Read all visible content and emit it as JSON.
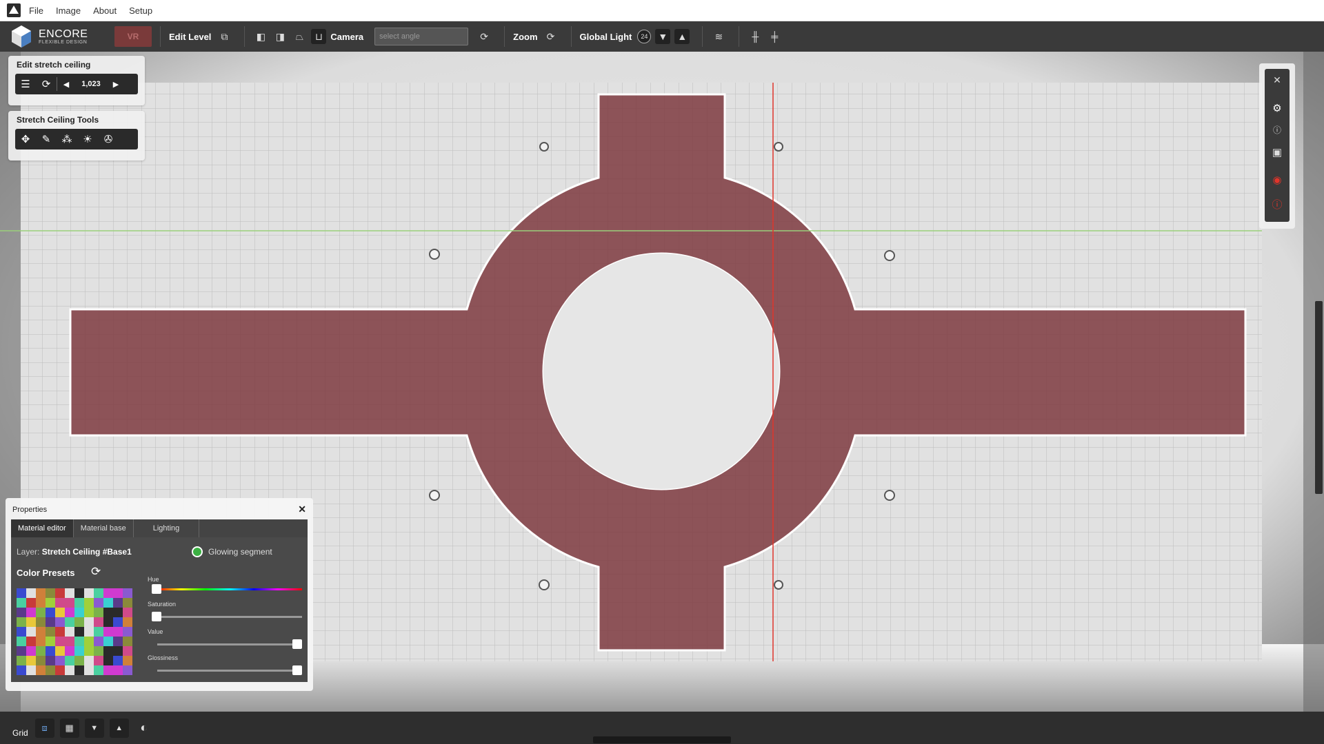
{
  "menubar": {
    "items": [
      "File",
      "Image",
      "About",
      "Setup"
    ]
  },
  "brand": {
    "name": "ENCORE",
    "subtitle": "FLEXIBLE DESIGN",
    "vr_label": "VR"
  },
  "toolbar": {
    "edit_level_label": "Edit Level",
    "camera_label": "Camera",
    "select_angle_placeholder": "select angle",
    "zoom_label": "Zoom",
    "global_light_label": "Global Light",
    "global_light_value": "24"
  },
  "edit_panel": {
    "title": "Edit stretch ceiling",
    "value": "1,023"
  },
  "tools_panel": {
    "title": "Stretch Ceiling Tools"
  },
  "properties": {
    "title": "Properties",
    "tabs": [
      "Material editor",
      "Material base",
      "Lighting"
    ],
    "layer_prefix": "Layer:",
    "layer_name": "Stretch Ceiling #Base1",
    "glowing_label": "Glowing segment",
    "presets_title": "Color Presets",
    "sliders": [
      {
        "label": "Hue",
        "value": 0.0
      },
      {
        "label": "Saturation",
        "value": 0.0
      },
      {
        "label": "Value",
        "value": 1.0
      },
      {
        "label": "Glossiness",
        "value": 1.0
      }
    ]
  },
  "bottombar": {
    "grid_label": "Grid"
  },
  "colors": {
    "accent_red": "#e0342a",
    "ceiling_fill": "#7e3a3f",
    "toolbar_bg": "#3a3a3a",
    "glow_green": "#3cb043"
  }
}
